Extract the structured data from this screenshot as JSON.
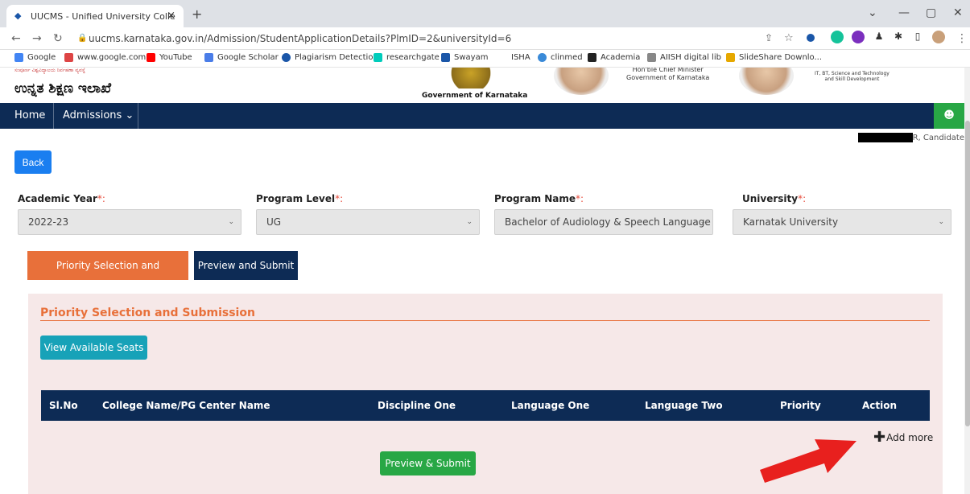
{
  "browser": {
    "tab_title": "UUCMS - Unified University Colle",
    "tab_close": "×",
    "new_tab": "+",
    "url": "uucms.karnataka.gov.in/Admission/StudentApplicationDetails?PlmID=2&universityId=6",
    "bookmarks": [
      "Google",
      "www.google.com",
      "YouTube",
      "Google Scholar",
      "Plagiarism Detectio...",
      "researchgate",
      "Swayam",
      "ISHA",
      "clinmed",
      "Academia",
      "AIISH digital lib",
      "SlideShare Downlo..."
    ]
  },
  "header": {
    "kannada_small": "ಸಂಪೂರ್ಣ ವಿಶ್ವವಿದ್ಯಾಲಯ ನಿರ್ವಹಣಾ ವ್ಯವಸ್ಥೆ",
    "kannada_title": "ಉನ್ನತ ಶಿಕ್ಷಣ ಇಲಾಖೆ",
    "gov_caption": "Government of Karnataka",
    "cm_line1": "Hon'ble Chief Minister",
    "cm_line2": "Government of Karnataka",
    "min_line1": "IT, BT, Science and Technology",
    "min_line2": "and Skill Development"
  },
  "nav": {
    "home": "Home",
    "admissions": "Admissions ⌄",
    "user_icon": "☻"
  },
  "candidate_label": "R, Candidate",
  "back_label": "Back",
  "form": {
    "academic_year_label": "Academic Year",
    "academic_year_value": "2022-23",
    "program_level_label": "Program Level",
    "program_level_value": "UG",
    "program_name_label": "Program Name",
    "program_name_value": "Bachelor of Audiology & Speech Language",
    "university_label": "University",
    "university_value": "Karnatak University",
    "req": "*:"
  },
  "tabs": {
    "priority": "Priority Selection and Submission",
    "preview": "Preview and Submit"
  },
  "panel": {
    "title": "Priority Selection and Submission",
    "view_seats": "View Available Seats",
    "columns": [
      "Sl.No",
      "College Name/PG Center Name",
      "Discipline One",
      "Language One",
      "Language Two",
      "Priority",
      "Action"
    ],
    "add_more": "Add more",
    "preview_submit": "Preview & Submit"
  },
  "colors": {
    "navy": "#0d2b55",
    "orange": "#e8703a",
    "green": "#28a745",
    "teal": "#17a2b8",
    "blue": "#1a7ef0"
  }
}
